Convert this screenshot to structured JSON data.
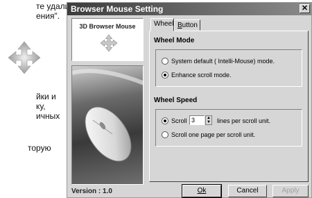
{
  "background_document": {
    "lines": [
      "те удалить",
      "ения\".",
      "йки и",
      "ку,",
      "ичных",
      "торую"
    ]
  },
  "window": {
    "title": "Browser Mouse Setting",
    "logo_title": "3D Browser Mouse",
    "version": "Version : 1.0",
    "tabs": [
      {
        "label": "Wheel",
        "active": true
      },
      {
        "label_prefix": "B",
        "label_rest": "utton",
        "active": false
      }
    ],
    "wheel_mode": {
      "title": "Wheel Mode",
      "options": [
        {
          "label": "System default ( Intelli-Mouse) mode.",
          "selected": false
        },
        {
          "label": "Enhance scroll mode.",
          "selected": true
        }
      ]
    },
    "wheel_speed": {
      "title": "Wheel Speed",
      "scroll_label": "Scroll",
      "scroll_value": "3",
      "scroll_suffix": "lines per scroll unit.",
      "page_option": "Scroll one page per scroll unit.",
      "selected": "scroll"
    },
    "buttons": {
      "ok": "Ok",
      "cancel": "Cancel",
      "apply": "Apply"
    }
  }
}
